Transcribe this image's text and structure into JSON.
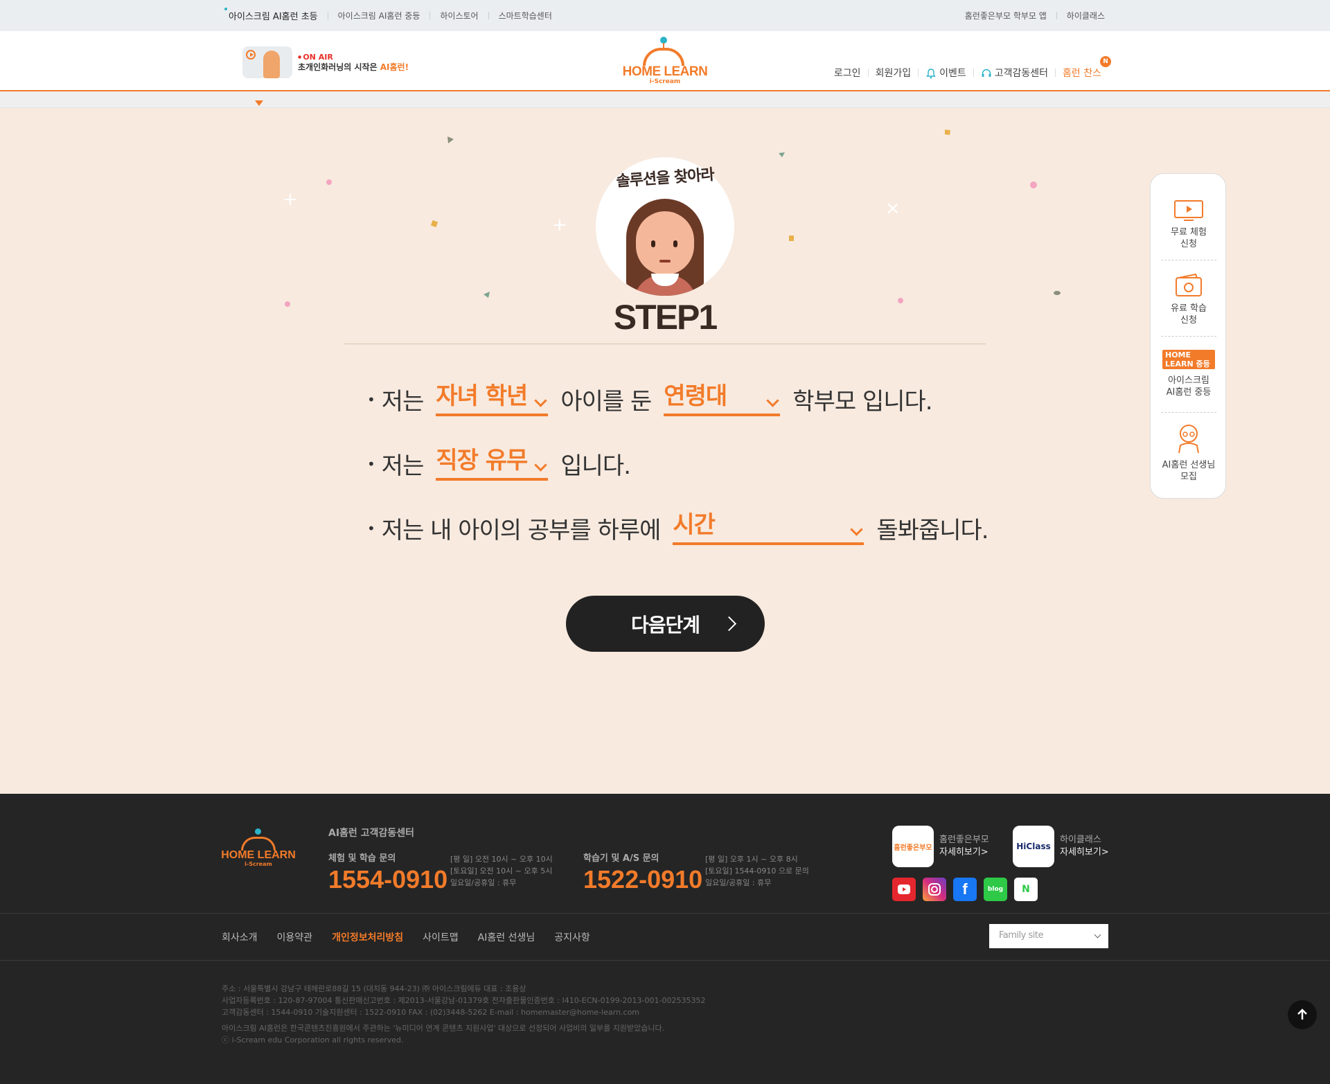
{
  "topbar": {
    "links": [
      "아이스크림 AI홈런 초등",
      "아이스크림 AI홈런 중등",
      "하이스토어",
      "스마트학습센터"
    ],
    "right": [
      "홈런좋은부모 학부모 앱",
      "하이클래스"
    ]
  },
  "header": {
    "onair_badge": "ON AIR",
    "onair_text_a": "초개인화러닝의 시작은 ",
    "onair_text_b": "AI홈런!",
    "logo_word": "HOME LEARN",
    "logo_sub": "i-Scream",
    "nav": {
      "login": "로그인",
      "signup": "회원가입",
      "event": "이벤트",
      "support": "고객감동센터",
      "chance": "홈런 찬스",
      "badge": "N"
    }
  },
  "hero": {
    "title": "솔루션을 찾아라",
    "step": "STEP1"
  },
  "questions": {
    "q1": {
      "a": "저는",
      "select1": "자녀 학년",
      "b": "아이를 둔",
      "select2": "연령대",
      "c": "학부모 입니다."
    },
    "q2": {
      "a": "저는",
      "select1": "직장 유무",
      "b": "입니다."
    },
    "q3": {
      "a": "저는 내 아이의 공부를 하루에",
      "select1": "시간",
      "b": "돌봐줍니다."
    }
  },
  "next_button": "다음단계",
  "quick_menu": {
    "free": [
      "무료 체험",
      "신청"
    ],
    "paid": [
      "유료 학습",
      "신청"
    ],
    "middle_badge": "HOME LEARN 중등",
    "middle": [
      "아이스크림",
      "AI홈런 중등"
    ],
    "teacher": [
      "AI홈런 선생님",
      "모집"
    ]
  },
  "footer": {
    "logo_word": "HOME LEARN",
    "logo_sub": "i-Scream",
    "center_title": "AI홈런 고객감동센터",
    "contact1": {
      "label": "체험 및 학습 문의",
      "number": "1554-0910",
      "hours": [
        "[평 일] 오전 10시 ~ 오후 10시",
        "[토요일] 오전 10시 ~ 오후 5시",
        "일요일/공휴일 : 휴무"
      ]
    },
    "contact2": {
      "label": "학습기 및 A/S 문의",
      "number": "1522-0910",
      "hours": [
        "[평 일] 오후 1시 ~ 오후 8시",
        "[토요일] 1544-0910 으로 문의",
        "일요일/공휴일 : 휴무"
      ]
    },
    "app1": {
      "name": "홈런좋은부모",
      "more": "자세히보기>",
      "icon_text": "홈런좋은부모"
    },
    "app2": {
      "name": "하이클래스",
      "more": "자세히보기>",
      "icon_text": "HiClass"
    },
    "sns": {
      "blog": "blog",
      "naver": "N"
    },
    "nav": [
      "회사소개",
      "이용약관",
      "개인정보처리방침",
      "사이트맵",
      "AI홈런 선생님",
      "공지사항"
    ],
    "family_site": "Family site",
    "info": [
      "주소 : 서울특별시 강남구 테헤란로88길 15 (대치동 944-23) ㈜ 아이스크림에듀     대표 : 조용상",
      "사업자등록번호 : 120-87-97004     통신판매신고번호 : 제2013-서울강남-01379호     전자출판물인증번호 : I410-ECN-0199-2013-001-002535352",
      "고객감동센터 : 1544-0910     기술지원센터 : 1522-0910     FAX : (02)3448-5262     E-mail : homemaster@home-learn.com"
    ],
    "notice": "아이스크림 AI홈런은 한국콘텐츠진흥원에서 주관하는 '뉴미디어 연계 콘텐츠 지원사업' 대상으로 선정되어 사업비의 일부를 지원받았습니다.",
    "copyright": "ⓒ i-Scream edu Corporation all rights reserved."
  },
  "colors": {
    "accent": "#f27b2a",
    "background": "#f8eadf",
    "footer": "#252525"
  }
}
